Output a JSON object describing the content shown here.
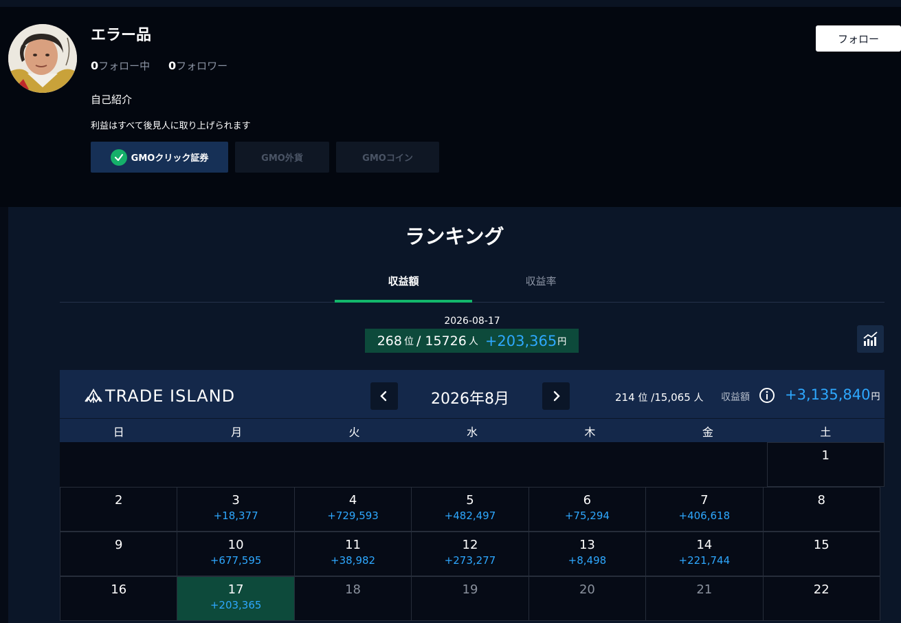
{
  "profile": {
    "username": "エラー品",
    "following_count": "0",
    "following_label": "フォロー中",
    "follower_count": "0",
    "follower_label": "フォロワー",
    "intro_heading": "自己紹介",
    "intro_text": "利益はすべて後見人に取り上げられます",
    "follow_button": "フォロー",
    "broker_tabs": [
      {
        "label": "GMOクリック証券",
        "active": true
      },
      {
        "label": "GMO外貨",
        "active": false
      },
      {
        "label": "GMOコイン",
        "active": false
      }
    ]
  },
  "ranking": {
    "title": "ランキング",
    "tabs": [
      {
        "label": "収益額",
        "active": true
      },
      {
        "label": "収益率",
        "active": false
      }
    ],
    "date": "2026-08-17",
    "rank": "268",
    "rank_unit": "位",
    "separator": "/",
    "total": "15726",
    "total_unit": "人",
    "profit": "+203,365",
    "profit_unit": "円"
  },
  "calendar": {
    "brand": "TRADE ISLAND",
    "month": "2026年8月",
    "month_rank": "214",
    "month_rank_unit": "位",
    "month_total": "/15,065",
    "month_total_unit": "人",
    "profit_label": "収益額",
    "month_profit": "+3,135,840",
    "month_profit_unit": "円",
    "weekdays": [
      "日",
      "月",
      "火",
      "水",
      "木",
      "金",
      "土"
    ],
    "weeks": [
      [
        {
          "day": ""
        },
        {
          "day": ""
        },
        {
          "day": ""
        },
        {
          "day": ""
        },
        {
          "day": ""
        },
        {
          "day": ""
        },
        {
          "day": "1",
          "amount": ""
        }
      ],
      [
        {
          "day": "2",
          "amount": ""
        },
        {
          "day": "3",
          "amount": "+18,377"
        },
        {
          "day": "4",
          "amount": "+729,593"
        },
        {
          "day": "5",
          "amount": "+482,497"
        },
        {
          "day": "6",
          "amount": "+75,294"
        },
        {
          "day": "7",
          "amount": "+406,618"
        },
        {
          "day": "8",
          "amount": ""
        }
      ],
      [
        {
          "day": "9",
          "amount": ""
        },
        {
          "day": "10",
          "amount": "+677,595"
        },
        {
          "day": "11",
          "amount": "+38,982"
        },
        {
          "day": "12",
          "amount": "+273,277"
        },
        {
          "day": "13",
          "amount": "+8,498"
        },
        {
          "day": "14",
          "amount": "+221,744"
        },
        {
          "day": "15",
          "amount": ""
        }
      ],
      [
        {
          "day": "16",
          "amount": ""
        },
        {
          "day": "17",
          "amount": "+203,365",
          "today": true
        },
        {
          "day": "18",
          "amount": "",
          "future": true
        },
        {
          "day": "19",
          "amount": "",
          "future": true
        },
        {
          "day": "20",
          "amount": "",
          "future": true
        },
        {
          "day": "21",
          "amount": "",
          "future": true
        },
        {
          "day": "22",
          "amount": ""
        }
      ]
    ]
  },
  "colors": {
    "accent_green": "#13b66b",
    "profit_blue": "#2ea8ff",
    "today_bg": "#0d4a3b",
    "header_bg": "#14284a"
  }
}
